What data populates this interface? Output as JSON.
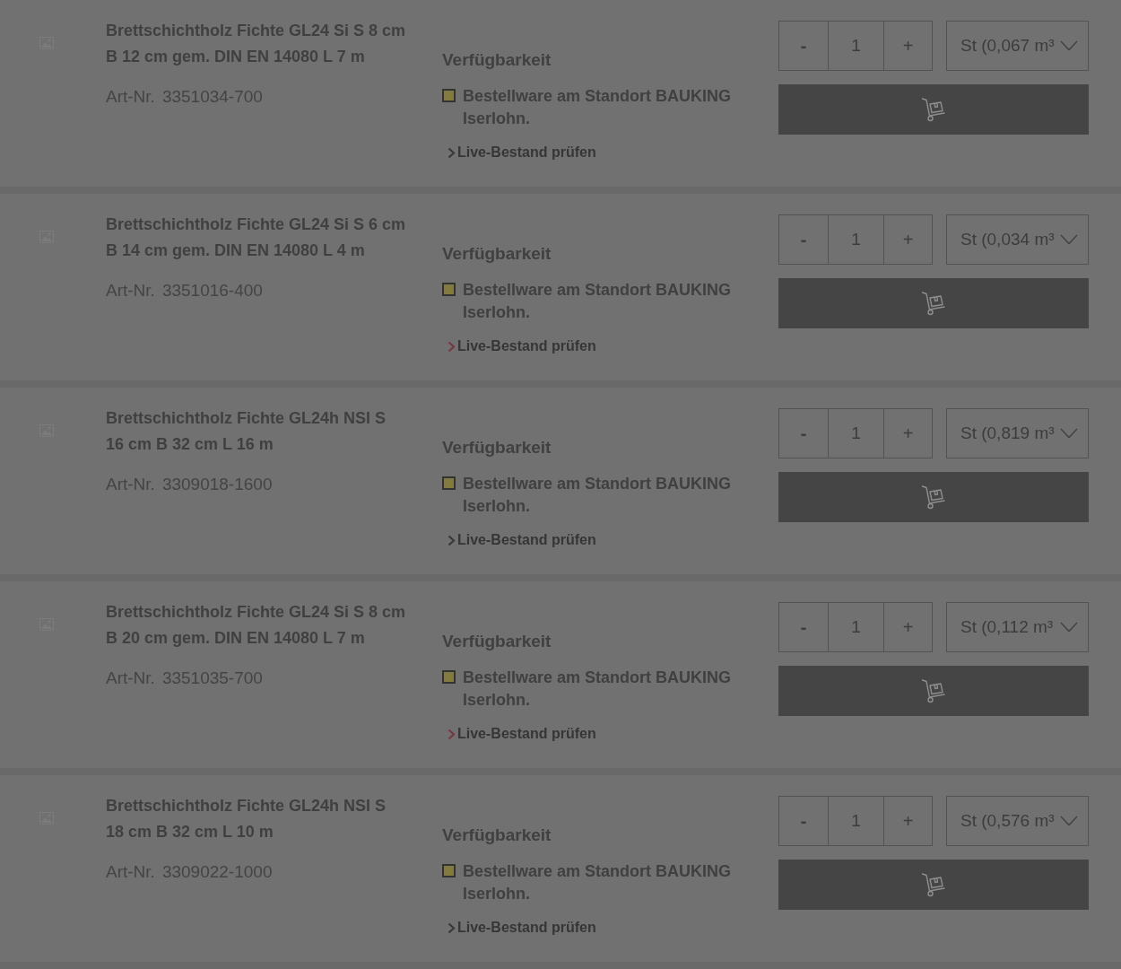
{
  "products": [
    {
      "title": [
        "Brettschichtholz Fichte GL24 Si S 8 cm",
        "B 12 cm gem. DIN EN 14080 L 7 m"
      ],
      "art_nr_label": "Art-Nr.",
      "art_nr": "3351034-700",
      "availability_heading": "Verfügbarkeit",
      "status": {
        "text": "Bestellware am Standort BAUKING Iserlohn.",
        "color": "#857a3e"
      },
      "link": {
        "text": "Live-Bestand prüfen",
        "color": "#383838"
      },
      "minus": "-",
      "quantity": "1",
      "plus": "+",
      "unit": "St (0,067 m³"
    },
    {
      "title": [
        "Brettschichtholz Fichte GL24 Si S 6 cm",
        "B 14 cm gem. DIN EN 14080 L 4 m"
      ],
      "art_nr_label": "Art-Nr.",
      "art_nr": "3351016-400",
      "availability_heading": "Verfügbarkeit",
      "status": {
        "text": "Bestellware am Standort BAUKING Iserlohn.",
        "color": "#857a3e"
      },
      "link": {
        "text": "Live-Bestand prüfen",
        "color": "#7a3640"
      },
      "minus": "-",
      "quantity": "1",
      "plus": "+",
      "unit": "St (0,034 m³"
    },
    {
      "title": [
        "Brettschichtholz Fichte GL24h NSI S",
        "16 cm B 32 cm L 16 m"
      ],
      "art_nr_label": "Art-Nr.",
      "art_nr": "3309018-1600",
      "availability_heading": "Verfügbarkeit",
      "status": {
        "text": "Bestellware am Standort BAUKING Iserlohn.",
        "color": "#857a3e"
      },
      "link": {
        "text": "Live-Bestand prüfen",
        "color": "#383838"
      },
      "minus": "-",
      "quantity": "1",
      "plus": "+",
      "unit": "St (0,819 m³"
    },
    {
      "title": [
        "Brettschichtholz Fichte GL24 Si S 8 cm",
        "B 20 cm gem. DIN EN 14080 L 7 m"
      ],
      "art_nr_label": "Art-Nr.",
      "art_nr": "3351035-700",
      "availability_heading": "Verfügbarkeit",
      "status": {
        "text": "Bestellware am Standort BAUKING Iserlohn.",
        "color": "#857a3e"
      },
      "link": {
        "text": "Live-Bestand prüfen",
        "color": "#7a3640"
      },
      "minus": "-",
      "quantity": "1",
      "plus": "+",
      "unit": "St (0,112 m³"
    },
    {
      "title": [
        "Brettschichtholz Fichte GL24h NSI S",
        "18 cm B 32 cm L 10 m"
      ],
      "art_nr_label": "Art-Nr.",
      "art_nr": "3309022-1000",
      "availability_heading": "Verfügbarkeit",
      "status": {
        "text": "Bestellware am Standort BAUKING Iserlohn.",
        "color": "#857a3e"
      },
      "link": {
        "text": "Live-Bestand prüfen",
        "color": "#383838"
      },
      "minus": "-",
      "quantity": "1",
      "plus": "+",
      "unit": "St (0,576 m³"
    }
  ]
}
